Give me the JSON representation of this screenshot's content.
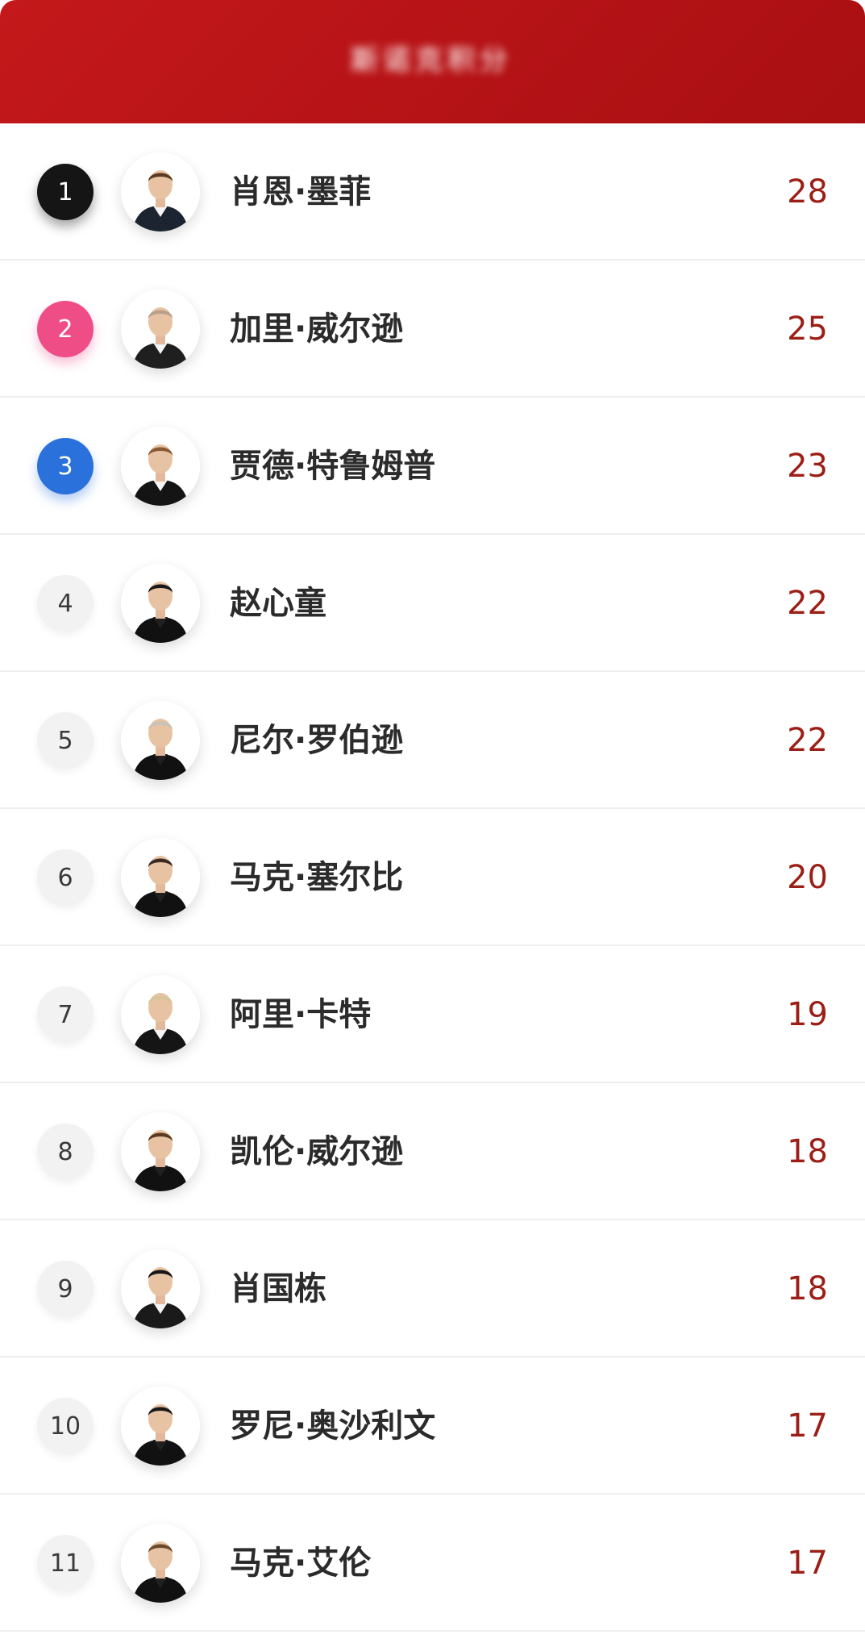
{
  "header": {
    "title": "斯诺克积分"
  },
  "colors": {
    "header_bg": "#b8141a",
    "score": "#9c1f17",
    "rank1": "#151515",
    "rank2": "#ee4d86",
    "rank3": "#2a71dc"
  },
  "rows": [
    {
      "rank": "1",
      "name": "肖恩·墨菲",
      "score": "28",
      "shirt": "white",
      "hair": "#5a3a22",
      "vest": "#1b2430"
    },
    {
      "rank": "2",
      "name": "加里·威尔逊",
      "score": "25",
      "shirt": "white",
      "hair": "#b9a089",
      "vest": "#1f1f1f"
    },
    {
      "rank": "3",
      "name": "贾德·特鲁姆普",
      "score": "23",
      "shirt": "white",
      "hair": "#8a5a35",
      "vest": "#141414"
    },
    {
      "rank": "4",
      "name": "赵心童",
      "score": "22",
      "shirt": "black",
      "hair": "#1a1a1a",
      "vest": "#111111"
    },
    {
      "rank": "5",
      "name": "尼尔·罗伯逊",
      "score": "22",
      "shirt": "black",
      "hair": "#c9c2b6",
      "vest": "#111111"
    },
    {
      "rank": "6",
      "name": "马克·塞尔比",
      "score": "20",
      "shirt": "black",
      "hair": "#3a2a22",
      "vest": "#111111"
    },
    {
      "rank": "7",
      "name": "阿里·卡特",
      "score": "19",
      "shirt": "white",
      "hair": "#d8c49b",
      "vest": "#151515"
    },
    {
      "rank": "8",
      "name": "凯伦·威尔逊",
      "score": "18",
      "shirt": "black",
      "hair": "#5a3a22",
      "vest": "#111111"
    },
    {
      "rank": "9",
      "name": "肖国栋",
      "score": "18",
      "shirt": "white",
      "hair": "#161616",
      "vest": "#1a1a1a"
    },
    {
      "rank": "10",
      "name": "罗尼·奥沙利文",
      "score": "17",
      "shirt": "black",
      "hair": "#1a1a1a",
      "vest": "#111111"
    },
    {
      "rank": "11",
      "name": "马克·艾伦",
      "score": "17",
      "shirt": "black",
      "hair": "#6b4a2b",
      "vest": "#111111"
    }
  ]
}
